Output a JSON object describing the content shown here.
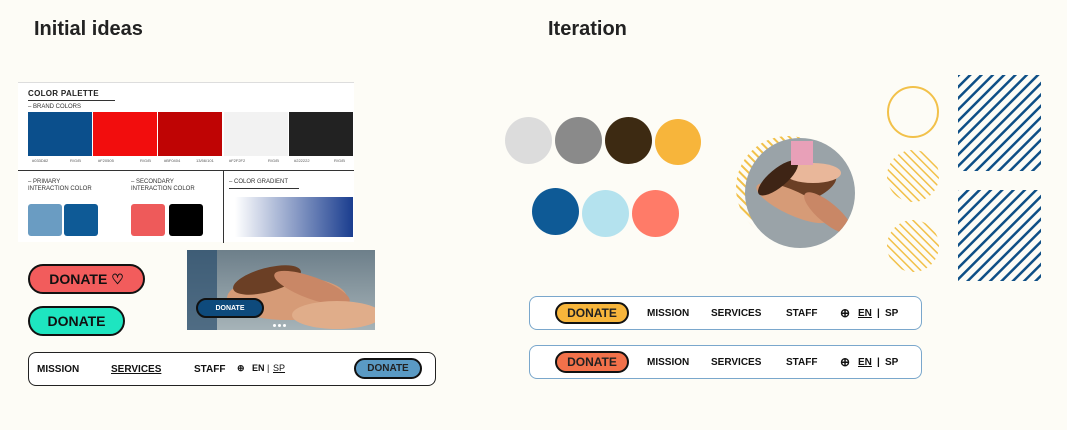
{
  "headings": {
    "initial": "Initial ideas",
    "iteration": "Iteration"
  },
  "palette": {
    "title": "COLOR PALETTE",
    "brand_label": "– BRAND COLORS",
    "brand_colors": [
      {
        "hex": "#0b4f8c",
        "code": "#033D82",
        "rgb": "R/G/B"
      },
      {
        "hex": "#f20d0d",
        "code": "#F20505",
        "rgb": "R/G/B"
      },
      {
        "hex": "#bf0404",
        "code": "#BF0404",
        "rgb": "13/56/101"
      },
      {
        "hex": "#f2f2f2",
        "code": "#F2F2F2",
        "rgb": "R/G/B"
      },
      {
        "hex": "#222222",
        "code": "#222222",
        "rgb": "R/G/B"
      }
    ],
    "primary_label": "– PRIMARY\nINTERACTION COLOR",
    "secondary_label": "– SECONDARY\nINTERACTION COLOR",
    "gradient_label": "– COLOR GRADIENT",
    "primary_colors": [
      "#6a9cc2",
      "#0e5a96"
    ],
    "secondary_colors": [
      "#ee5a5a",
      "#000000"
    ]
  },
  "initial": {
    "donate_red": {
      "label": "DONATE ♡",
      "color": "#f25c5c"
    },
    "donate_teal": {
      "label": "DONATE",
      "color": "#1ee5c0"
    },
    "photo_button": "DONATE",
    "nav": {
      "mission": "MISSION",
      "services": "SERVICES",
      "staff": "STAFF",
      "en": "EN",
      "sep": "|",
      "sp": "SP",
      "donate": "DONATE",
      "donate_color": "#5a9ac4"
    }
  },
  "iteration": {
    "circles_row1": [
      "#dcdcdc",
      "#8a8a8a",
      "#3d2a12",
      "#f7b53b"
    ],
    "circles_row2": [
      "#0e5a96",
      "#b4e2ee",
      "#ff7b68"
    ],
    "nav1": {
      "donate": "DONATE",
      "donate_color": "#f7b53b",
      "mission": "MISSION",
      "services": "SERVICES",
      "staff": "STAFF",
      "en": "EN",
      "sep": "|",
      "sp": "SP"
    },
    "nav2": {
      "donate": "DONATE",
      "donate_color": "#f2714a",
      "mission": "MISSION",
      "services": "SERVICES",
      "staff": "STAFF",
      "en": "EN",
      "sep": "|",
      "sp": "SP"
    }
  }
}
